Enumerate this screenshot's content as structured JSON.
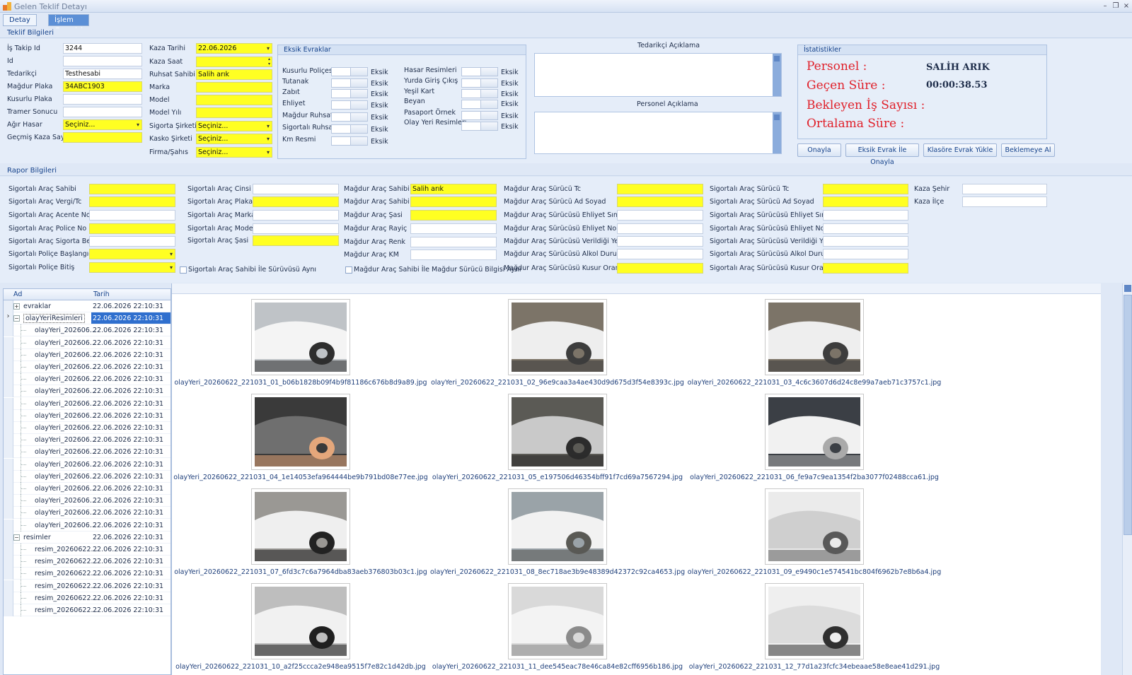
{
  "window": {
    "title": "Gelen Teklif Detayı",
    "buttons": [
      "–",
      "❐",
      "×"
    ]
  },
  "tabs": [
    "Detay",
    "İşlem Geçmişi"
  ],
  "teklif": {
    "section": "Teklif Bilgileri",
    "left_labels": [
      "İş Takip Id",
      "Id",
      "Tedarikçi",
      "Mağdur Plaka",
      "Kusurlu Plaka",
      "Tramer Sonucu",
      "Ağır Hasar",
      "Geçmiş Kaza Sayısı"
    ],
    "left_values": [
      "3244",
      "",
      "Testhesabi",
      "34ABC1903",
      "",
      "",
      "Seçiniz...",
      ""
    ],
    "mid_labels": [
      "Kaza Tarihi",
      "Kaza Saat",
      "Ruhsat Sahibi",
      "Marka",
      "Model",
      "Model Yılı",
      "Sigorta Şirketi",
      "Kasko Şirketi",
      "Firma/Şahıs"
    ],
    "mid_values": [
      "22.06.2026",
      "",
      "Salih arık",
      "",
      "",
      "",
      "Seçiniz...",
      "Seçiniz...",
      "Seçiniz..."
    ]
  },
  "eksik": {
    "title": "Eksik Evraklar",
    "left_items": [
      "Kusurlu Poliçesi",
      "Tutanak",
      "Zabıt",
      "Ehliyet",
      "Mağdur Ruhsat",
      "Sigortalı Ruhsat",
      "Km Resmi"
    ],
    "right_items": [
      "Hasar Resimleri",
      "Yurda Giriş Çıkış",
      "Yeşil Kart",
      "Beyan",
      "Pasaport Örnek",
      "Olay Yeri Resimleri"
    ],
    "status": "Eksik"
  },
  "aciklama": {
    "tedarikci": "Tedarikçi  Açıklama",
    "personel": "Personel  Açıklama"
  },
  "istatistik": {
    "title": "İstatistikler",
    "personel_label": "Personel :",
    "personel_value": "SALİH ARIK",
    "gecen_label": "Geçen Süre :",
    "gecen_value": "00:00:38.53",
    "bekleyen_label": "Bekleyen İş Sayısı :",
    "ortalama_label": "Ortalama Süre :"
  },
  "buttons": [
    "Onayla",
    "Eksik Evrak İle Onayla",
    "Klasöre Evrak Yükle",
    "Beklemeye Al"
  ],
  "rapor": {
    "section": "Rapor Bilgileri",
    "col1": [
      "Sigortalı Araç Sahibi",
      "Sigortalı Araç Vergi/Tc",
      "Sigortalı Araç Acente No",
      "Sigortalı Araç Police No",
      "Sigortalı Araç Sigorta Bedel",
      "Sigortalı  Poliçe Başlangıç",
      "Sigortalı Poliçe Bitiş"
    ],
    "col2": [
      "Sigortalı Araç Cinsi",
      "Sigortalı Araç Plaka",
      "Sigortalı Araç Marka",
      "Sigortalı Araç Model",
      "Sigortalı Araç Şasi"
    ],
    "col3": [
      "Mağdur Araç Sahibi",
      "Mağdur Araç Sahibi TC",
      "Mağdur Araç Şasi",
      "Mağdur Araç Rayiç",
      "Mağdur Araç Renk",
      "Mağdur Araç KM"
    ],
    "col3_first_value": "Salih arık",
    "col4": [
      "Mağdur Araç Sürücü Tc",
      "Mağdur Araç Sürücü Ad Soyad",
      "Mağdur Araç Sürücüsü Ehliyet Sınıfı",
      "Mağdur Araç Sürücüsü Ehliyet No",
      "Mağdur Araç Sürücüsü Verildiği Yer",
      "Mağdur Araç Sürücüsü  Alkol Durumu",
      "Mağdur Araç Sürücüsü Kusur Oranı"
    ],
    "col5": [
      "Sigortalı Araç Sürücü Tc",
      "Sigortalı Araç Sürücü Ad Soyad",
      "Sigortalı Araç Sürücüsü Ehliyet Sınıfı",
      "Sigortalı Araç Sürücüsü Ehliyet No",
      "Sigortalı Araç Sürücüsü Verildiği Yer",
      "Sigortalı Araç Sürücüsü  Alkol Durumu",
      "Sigortalı Araç Sürücüsü Kusur Oranı"
    ],
    "col6": [
      "Kaza Şehir",
      "Kaza İlçe"
    ],
    "check1": "Sigortalı Araç Sahibi İle Sürüvüsü Aynı",
    "check2": "Mağdur Araç Sahibi İle Mağdur Sürücü Bilgisi Aynı"
  },
  "tree": {
    "col_ad": "Ad",
    "col_tarih": "Tarih",
    "date": "22.06.2026 22:10:31",
    "folders": [
      "evraklar",
      "olayYeriResimleri",
      "resimler"
    ],
    "olay_child": "olayYeri_202606...",
    "resim_child": "resim_20260622...",
    "olay_count": 17,
    "resim_count": 6
  },
  "gallery": {
    "images": [
      "olayYeri_20260622_221031_01_b06b1828b09f4b9f81186c676b8d9a89.jpg",
      "olayYeri_20260622_221031_02_96e9caa3a4ae430d9d675d3f54e8393c.jpg",
      "olayYeri_20260622_221031_03_4c6c3607d6d24c8e99a7aeb71c3757c1.jpg",
      "olayYeri_20260622_221031_04_1e14053efa964444be9b791bd08e77ee.jpg",
      "olayYeri_20260622_221031_05_e197506d46354bff91f7cd69a7567294.jpg",
      "olayYeri_20260622_221031_06_fe9a7c9ea1354f2ba3077f02488cca61.jpg",
      "olayYeri_20260622_221031_07_6fd3c7c6a7964dba83aeb376803b03c1.jpg",
      "olayYeri_20260622_221031_08_8ec718ae3b9e48389d42372c92ca4653.jpg",
      "olayYeri_20260622_221031_09_e9490c1e574541bc804f6962b7e8b6a4.jpg",
      "olayYeri_20260622_221031_10_a2f25ccca2e948ea9515f7e82c1d42db.jpg",
      "olayYeri_20260622_221031_11_dee545eac78e46ca84e82cff6956b186.jpg",
      "olayYeri_20260622_221031_12_77d1a23fcfc34ebeaae58e8eae41d291.jpg"
    ],
    "photo_kinds": [
      "door",
      "car-front",
      "car-front",
      "engine",
      "bumper",
      "car-rear",
      "wheel",
      "street",
      "panel",
      "front-damage",
      "panel2",
      "wheel-arch"
    ]
  }
}
